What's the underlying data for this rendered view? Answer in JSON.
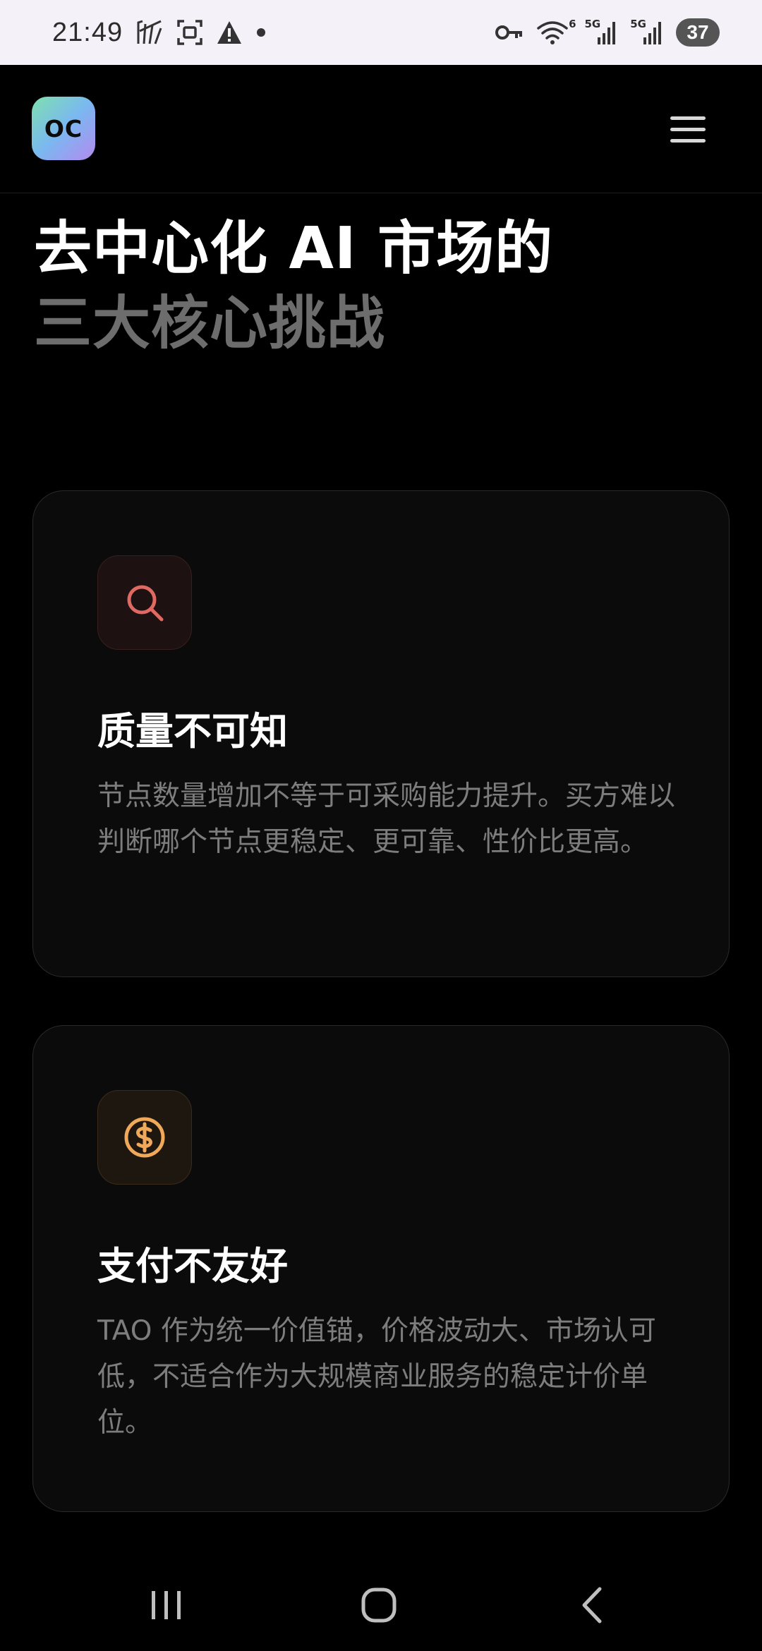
{
  "status_bar": {
    "time": "21:49",
    "net1": "5G",
    "net2": "5G",
    "wifi_label": "6",
    "battery": "37"
  },
  "app": {
    "logo_text": "OC"
  },
  "hero": {
    "title_line1": "去中心化 AI 市场的",
    "title_line2": "三大核心挑战"
  },
  "cards": [
    {
      "icon": "search-icon",
      "title": "质量不可知",
      "description": "节点数量增加不等于可采购能力提升。买方难以判断哪个节点更稳定、更可靠、性价比更高。",
      "accent": "#e06a63"
    },
    {
      "icon": "dollar-circle-icon",
      "title": "支付不友好",
      "description": "TAO 作为统一价值锚，价格波动大、市场认可低，不适合作为大规模商业服务的稳定计价单位。",
      "accent": "#f0a85a"
    }
  ],
  "colors": {
    "background": "#000000",
    "card_background": "#0b0b0b",
    "title_secondary": "#6d6d6d",
    "body_text": "#7d7d7d"
  }
}
